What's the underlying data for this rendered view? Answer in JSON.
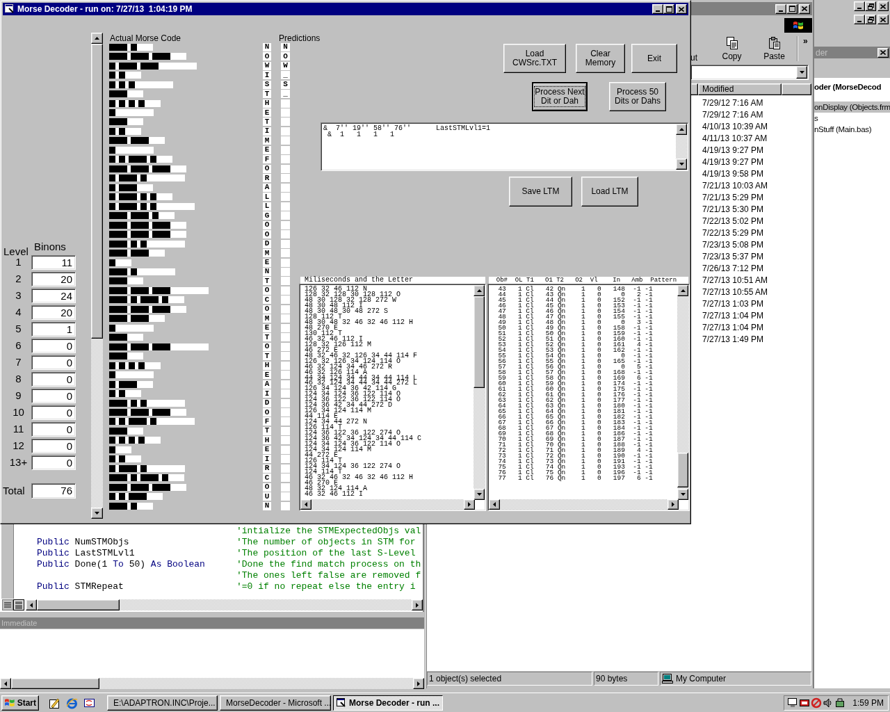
{
  "main_window": {
    "title": "Morse Decoder - run on: 7/27/13  1:04:19 PM",
    "levels": {
      "level_heading": "Level",
      "binons_heading": "Binons",
      "total_label": "Total",
      "total": "76",
      "rows": [
        {
          "level": "1",
          "binons": "11"
        },
        {
          "level": "2",
          "binons": "20"
        },
        {
          "level": "3",
          "binons": "24"
        },
        {
          "level": "4",
          "binons": "20"
        },
        {
          "level": "5",
          "binons": "1"
        },
        {
          "level": "6",
          "binons": "0"
        },
        {
          "level": "7",
          "binons": "0"
        },
        {
          "level": "8",
          "binons": "0"
        },
        {
          "level": "9",
          "binons": "0"
        },
        {
          "level": "10",
          "binons": "0"
        },
        {
          "level": "11",
          "binons": "0"
        },
        {
          "level": "12",
          "binons": "0"
        },
        {
          "level": "13+",
          "binons": "0"
        }
      ]
    },
    "morse": {
      "heading": "Actual Morse Code",
      "predictions_heading": "Predictions",
      "rows": [
        {
          "letter": "N",
          "elements": [
            {
              "kind": "dah"
            },
            {
              "kind": "dit"
            }
          ],
          "word_end": false,
          "prediction": "N"
        },
        {
          "letter": "O",
          "elements": [
            {
              "kind": "dah"
            },
            {
              "kind": "dah"
            },
            {
              "kind": "dah"
            }
          ],
          "word_end": false,
          "prediction": "O"
        },
        {
          "letter": "W",
          "elements": [
            {
              "kind": "dit"
            },
            {
              "kind": "dah"
            },
            {
              "kind": "dah"
            }
          ],
          "word_end": true,
          "prediction": "W"
        },
        {
          "letter": "I",
          "elements": [
            {
              "kind": "dit"
            },
            {
              "kind": "dit"
            }
          ],
          "word_end": false,
          "prediction": "_"
        },
        {
          "letter": "S",
          "elements": [
            {
              "kind": "dit"
            },
            {
              "kind": "dit"
            },
            {
              "kind": "dit"
            }
          ],
          "word_end": true,
          "prediction": "S"
        },
        {
          "letter": "T",
          "elements": [
            {
              "kind": "dah"
            }
          ],
          "word_end": false,
          "prediction": "_"
        },
        {
          "letter": "H",
          "elements": [
            {
              "kind": "dit"
            },
            {
              "kind": "dit"
            },
            {
              "kind": "dit"
            },
            {
              "kind": "dit"
            }
          ],
          "word_end": false
        },
        {
          "letter": "E",
          "elements": [
            {
              "kind": "dit"
            }
          ],
          "word_end": true
        },
        {
          "letter": "T",
          "elements": [
            {
              "kind": "dah"
            }
          ],
          "word_end": false
        },
        {
          "letter": "I",
          "elements": [
            {
              "kind": "dit"
            },
            {
              "kind": "dit"
            }
          ],
          "word_end": false
        },
        {
          "letter": "M",
          "elements": [
            {
              "kind": "dah"
            },
            {
              "kind": "dah"
            }
          ],
          "word_end": false
        },
        {
          "letter": "E",
          "elements": [
            {
              "kind": "dit"
            }
          ],
          "word_end": true
        },
        {
          "letter": "F",
          "elements": [
            {
              "kind": "dit"
            },
            {
              "kind": "dit"
            },
            {
              "kind": "dah"
            },
            {
              "kind": "dit"
            }
          ],
          "word_end": false
        },
        {
          "letter": "O",
          "elements": [
            {
              "kind": "dah"
            },
            {
              "kind": "dah"
            },
            {
              "kind": "dah"
            }
          ],
          "word_end": false
        },
        {
          "letter": "R",
          "elements": [
            {
              "kind": "dit"
            },
            {
              "kind": "dah"
            },
            {
              "kind": "dit"
            }
          ],
          "word_end": true
        },
        {
          "letter": "A",
          "elements": [
            {
              "kind": "dit"
            },
            {
              "kind": "dah"
            }
          ],
          "word_end": false
        },
        {
          "letter": "L",
          "elements": [
            {
              "kind": "dit"
            },
            {
              "kind": "dah"
            },
            {
              "kind": "dit"
            },
            {
              "kind": "dit"
            }
          ],
          "word_end": false
        },
        {
          "letter": "L",
          "elements": [
            {
              "kind": "dit"
            },
            {
              "kind": "dah"
            },
            {
              "kind": "dit"
            },
            {
              "kind": "dit"
            }
          ],
          "word_end": true
        },
        {
          "letter": "G",
          "elements": [
            {
              "kind": "dah"
            },
            {
              "kind": "dah"
            },
            {
              "kind": "dit"
            }
          ],
          "word_end": false
        },
        {
          "letter": "O",
          "elements": [
            {
              "kind": "dah"
            },
            {
              "kind": "dah"
            },
            {
              "kind": "dah"
            }
          ],
          "word_end": false
        },
        {
          "letter": "O",
          "elements": [
            {
              "kind": "dah"
            },
            {
              "kind": "dah"
            },
            {
              "kind": "dah"
            }
          ],
          "word_end": false
        },
        {
          "letter": "D",
          "elements": [
            {
              "kind": "dah"
            },
            {
              "kind": "dit"
            },
            {
              "kind": "dit"
            }
          ],
          "word_end": true
        },
        {
          "letter": "M",
          "elements": [
            {
              "kind": "dah"
            },
            {
              "kind": "dah"
            }
          ],
          "word_end": false
        },
        {
          "letter": "E",
          "elements": [
            {
              "kind": "dit"
            }
          ],
          "word_end": false
        },
        {
          "letter": "N",
          "elements": [
            {
              "kind": "dah"
            },
            {
              "kind": "dit"
            }
          ],
          "word_end": true
        },
        {
          "letter": "T",
          "elements": [
            {
              "kind": "dah"
            }
          ],
          "word_end": false
        },
        {
          "letter": "O",
          "elements": [
            {
              "kind": "dah"
            },
            {
              "kind": "dah"
            },
            {
              "kind": "dah"
            }
          ],
          "word_end": true
        },
        {
          "letter": "C",
          "elements": [
            {
              "kind": "dah"
            },
            {
              "kind": "dit"
            },
            {
              "kind": "dah"
            },
            {
              "kind": "dit"
            }
          ],
          "word_end": false
        },
        {
          "letter": "O",
          "elements": [
            {
              "kind": "dah"
            },
            {
              "kind": "dah"
            },
            {
              "kind": "dah"
            }
          ],
          "word_end": false
        },
        {
          "letter": "M",
          "elements": [
            {
              "kind": "dah"
            },
            {
              "kind": "dah"
            }
          ],
          "word_end": false
        },
        {
          "letter": "E",
          "elements": [
            {
              "kind": "dit"
            }
          ],
          "word_end": true
        },
        {
          "letter": "T",
          "elements": [
            {
              "kind": "dah"
            }
          ],
          "word_end": false
        },
        {
          "letter": "O",
          "elements": [
            {
              "kind": "dah"
            },
            {
              "kind": "dah"
            },
            {
              "kind": "dah"
            }
          ],
          "word_end": true
        },
        {
          "letter": "T",
          "elements": [
            {
              "kind": "dah"
            }
          ],
          "word_end": false
        },
        {
          "letter": "H",
          "elements": [
            {
              "kind": "dit"
            },
            {
              "kind": "dit"
            },
            {
              "kind": "dit"
            },
            {
              "kind": "dit"
            }
          ],
          "word_end": false
        },
        {
          "letter": "E",
          "elements": [
            {
              "kind": "dit"
            }
          ],
          "word_end": true
        },
        {
          "letter": "A",
          "elements": [
            {
              "kind": "dit"
            },
            {
              "kind": "dah"
            }
          ],
          "word_end": false
        },
        {
          "letter": "I",
          "elements": [
            {
              "kind": "dit"
            },
            {
              "kind": "dit"
            }
          ],
          "word_end": false
        },
        {
          "letter": "D",
          "elements": [
            {
              "kind": "dah"
            },
            {
              "kind": "dit"
            },
            {
              "kind": "dit"
            }
          ],
          "word_end": true
        },
        {
          "letter": "O",
          "elements": [
            {
              "kind": "dah"
            },
            {
              "kind": "dah"
            },
            {
              "kind": "dah"
            }
          ],
          "word_end": false
        },
        {
          "letter": "F",
          "elements": [
            {
              "kind": "dit"
            },
            {
              "kind": "dit"
            },
            {
              "kind": "dah"
            },
            {
              "kind": "dit"
            }
          ],
          "word_end": true
        },
        {
          "letter": "T",
          "elements": [
            {
              "kind": "dah"
            }
          ],
          "word_end": false
        },
        {
          "letter": "H",
          "elements": [
            {
              "kind": "dit"
            },
            {
              "kind": "dit"
            },
            {
              "kind": "dit"
            },
            {
              "kind": "dit"
            }
          ],
          "word_end": false
        },
        {
          "letter": "E",
          "elements": [
            {
              "kind": "dit"
            }
          ],
          "word_end": false
        },
        {
          "letter": "I",
          "elements": [
            {
              "kind": "dit"
            },
            {
              "kind": "dit"
            }
          ],
          "word_end": false
        },
        {
          "letter": "R",
          "elements": [
            {
              "kind": "dit"
            },
            {
              "kind": "dah"
            },
            {
              "kind": "dit"
            }
          ],
          "word_end": true
        },
        {
          "letter": "C",
          "elements": [
            {
              "kind": "dah"
            },
            {
              "kind": "dit"
            },
            {
              "kind": "dah"
            },
            {
              "kind": "dit"
            }
          ],
          "word_end": false
        },
        {
          "letter": "O",
          "elements": [
            {
              "kind": "dah"
            },
            {
              "kind": "dah"
            },
            {
              "kind": "dah"
            }
          ],
          "word_end": false
        },
        {
          "letter": "U",
          "elements": [
            {
              "kind": "dit"
            },
            {
              "kind": "dit"
            },
            {
              "kind": "dah"
            }
          ],
          "word_end": false
        },
        {
          "letter": "N",
          "elements": [
            {
              "kind": "dah"
            },
            {
              "kind": "dit"
            }
          ],
          "word_end": false
        }
      ]
    },
    "buttons": [
      {
        "lines": [
          "Load",
          "CWSrc.TXT"
        ],
        "focused": false
      },
      {
        "lines": [
          "Clear",
          "Memory"
        ],
        "focused": false
      },
      {
        "lines": [
          "Exit"
        ],
        "focused": false
      },
      {
        "lines": [
          "Process Next",
          "Dit or Dah"
        ],
        "focused": true
      },
      {
        "lines": [
          "Process 50",
          "Dits or Dahs"
        ],
        "focused": false
      },
      {
        "lines": [
          "Save LTM"
        ],
        "focused": false
      },
      {
        "lines": [
          "Load LTM"
        ],
        "focused": false
      }
    ],
    "stm_text": {
      "lines": [
        "&  7'' 19'' 58'' 76''      LastSTMLvl1=1",
        " &  1   1   1   1"
      ]
    },
    "ms_list": {
      "heading": "Miliseconds and the Letter",
      "items": [
        "126 32 46 112 N",
        "128 32 128 30 128 112 O",
        "48 30 128 32 128 272 W",
        "48 30 48 112 I",
        "48 30 48 30 48 272 S",
        "128 112 T",
        "48 30 48 32 46 32 46 112 H",
        "48 270 E",
        "130 112 T",
        "46 32 46 112 I",
        "128 32 126 112 M",
        "46 272 E",
        "48 32 46 32 126 34 44 114 F",
        "126 32 126 34 124 114 O",
        "46 32 124 34 46 272 R",
        "46 32 126 114 A",
        "44 34 124 34 44 34 44 114 L",
        "46 32 124 34 44 34 44 272 L",
        "126 34 124 36 42 114 G",
        "124 34 124 36 122 114 O",
        "124 36 122 36 122 114 O",
        "124 36 42 34 44 272 D",
        "126 34 124 114 M",
        "44 114 E",
        "124 34 44 272 N",
        "126 114 T",
        "124 36 122 36 122 274 O",
        "124 36 42 34 124 34 44 114 C",
        "124 34 124 36 122 114 O",
        "124 34 124 114 M",
        "44 272 E",
        "126 114 T",
        "124 34 124 36 122 274 O",
        "124 114 T",
        "46 32 46 32 46 32 46 112 H",
        "46 270 E",
        "48 32 124 114 A",
        "46 32 46 112 I"
      ]
    },
    "objects_list": {
      "heading": "  Ob#  OL T1   O1 T2   O2  Vl    In   Amb  Pattern",
      "items": [
        "  43   1 Cl   42 Qn    1   0   148  -1 -1",
        "  44   1 Cl   43 Qn    1   0     0   2 -1",
        "  45   1 Cl   44 Qn    1   0   152  -1 -1",
        "  46   1 Cl   45 Qn    1   0   153  -1 -1",
        "  47   1 Cl   46 Qn    1   0   154  -1 -1",
        "  48   1 Cl   47 Qn    1   0   155  -1 -1",
        "  49   1 Cl   48 Qn    1   0     0   3 -1",
        "  50   1 Cl   49 Qn    1   0   158  -1 -1",
        "  51   1 Cl   50 Qn    1   0   159  -1 -1",
        "  52   1 Cl   51 Qn    1   0   160  -1 -1",
        "  53   1 Cl   52 Qn    1   0   161   4 -1",
        "  54   1 Cl   53 Qn    1   0   162  -1 -1",
        "  55   1 Cl   54 Qn    1   0     0  -1 -1",
        "  56   1 Cl   55 Qn    1   0   165  -1 -1",
        "  57   1 Cl   56 Qn    1   0     0   5 -1",
        "  58   1 Cl   57 Qn    1   0   168  -1 -1",
        "  59   1 Cl   58 Qn    1   0   169   6 -1",
        "  60   1 Cl   59 Qn    1   0   174  -1 -1",
        "  61   1 Cl   60 Qn    1   0   175  -1 -1",
        "  62   1 Cl   61 Qn    1   0   176  -1 -1",
        "  63   1 Cl   62 Qn    1   0   177  -1 -1",
        "  64   1 Cl   63 Qn    1   0   180  -1 -1",
        "  65   1 Cl   64 Qn    1   0   181  -1 -1",
        "  66   1 Cl   65 Qn    1   0   182  -1 -1",
        "  67   1 Cl   66 Qn    1   0   183  -1 -1",
        "  68   1 Cl   67 Qn    1   0   184  -1 -1",
        "  69   1 Cl   68 Qn    1   0   186  -1 -1",
        "  70   1 Cl   69 Qn    1   0   187  -1 -1",
        "  71   1 Cl   70 Qn    1   0   188  -1 -1",
        "  72   1 Cl   71 Qn    1   0   189   4 -1",
        "  73   1 Cl   72 Qn    1   0   190  -1 -1",
        "  74   1 Cl   73 Qn    1   0   191  -1 -1",
        "  75   1 Cl   74 Qn    1   0   193  -1 -1",
        "  76   1 Cl   75 Qn    1   0   196  -1 -1",
        "  77   1 Cl   76 Qn    1   0   197   6 -1"
      ]
    }
  },
  "code_window": {
    "lines": [
      {
        "comment": "'intialize the STMExpectedObjs val"
      },
      {
        "segments": [
          {
            "kind": "keyword",
            "text": "Public"
          },
          {
            "kind": "plain",
            "text": " NumSTMObjs"
          }
        ],
        "comment": "'The number of objects in STM for"
      },
      {
        "segments": [
          {
            "kind": "keyword",
            "text": "Public"
          },
          {
            "kind": "plain",
            "text": " LastSTMLvl1"
          }
        ],
        "comment": "'The position of the last S-Level"
      },
      {
        "segments": [
          {
            "kind": "keyword",
            "text": "Public"
          },
          {
            "kind": "plain",
            "text": " Done(1 "
          },
          {
            "kind": "keyword",
            "text": "To"
          },
          {
            "kind": "plain",
            "text": " 50) "
          },
          {
            "kind": "keyword",
            "text": "As Boolean"
          }
        ],
        "comment": "'Done the find match process on th"
      },
      {
        "comment": "'The ones left false are removed f"
      },
      {
        "segments": [
          {
            "kind": "keyword",
            "text": "Public"
          },
          {
            "kind": "plain",
            "text": " STMRepeat"
          }
        ],
        "comment": "'=0 if no repeat else the entry i"
      }
    ]
  },
  "immediate_window": {
    "title": "Immediate"
  },
  "explorer_window": {
    "toolbar": [
      {
        "label": "ut"
      },
      {
        "label": "Copy"
      },
      {
        "label": "Paste"
      }
    ],
    "more": "»",
    "column": "Modified",
    "dates": [
      "7/29/12 7:16 AM",
      "7/29/12 7:16 AM",
      "4/10/13 10:39 AM",
      "4/11/13 10:37 AM",
      "4/19/13 9:27 PM",
      "4/19/13 9:27 PM",
      "4/19/13 9:58 PM",
      "7/21/13 10:03 AM",
      "7/21/13 5:29 PM",
      "7/21/13 5:30 PM",
      "7/22/13 5:02 PM",
      "7/22/13 5:29 PM",
      "7/23/13 5:08 PM",
      "7/23/13 5:37 PM",
      "7/26/13 7:12 PM",
      "7/27/13 10:51 AM",
      "7/27/13 10:55 AM",
      "7/27/13 1:03 PM",
      "7/27/13 1:04 PM",
      "7/27/13 1:04 PM",
      "7/27/13 1:49 PM"
    ],
    "status": [
      "1 object(s) selected",
      "90 bytes",
      "My Computer"
    ]
  },
  "project_explorer": {
    "title": "der",
    "items": [
      {
        "label": "oder (MorseDecod",
        "selected": false
      },
      {
        "label": "onDisplay (Objects.frm",
        "selected": true
      },
      {
        "label": "s",
        "selected": false
      },
      {
        "label": "nStuff (Main.bas)",
        "selected": false
      }
    ]
  },
  "taskbar": {
    "start": "Start",
    "tasks": [
      {
        "label": "E:\\ADAPTRON.INC\\Proje...",
        "selected": false
      },
      {
        "label": "MorseDecoder - Microsoft ...",
        "selected": false
      },
      {
        "label": "Morse Decoder - run ...",
        "selected": true
      }
    ],
    "clock": "1:59 PM"
  }
}
